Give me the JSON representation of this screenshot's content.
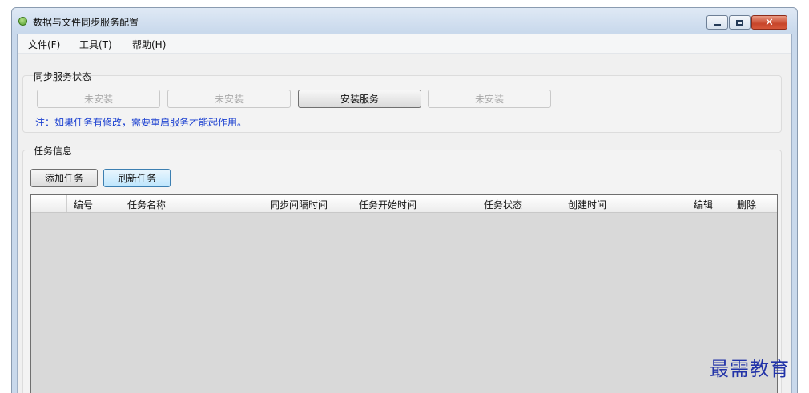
{
  "window": {
    "title": "数据与文件同步服务配置",
    "controls": {
      "minimize": "minimize-icon",
      "maximize": "maximize-icon",
      "close_glyph": "✕"
    }
  },
  "menu": [
    "文件(F)",
    "工具(T)",
    "帮助(H)"
  ],
  "service_status": {
    "title": "同步服务状态",
    "buttons": [
      {
        "label": "未安装",
        "enabled": false
      },
      {
        "label": "未安装",
        "enabled": false
      },
      {
        "label": "安装服务",
        "enabled": true
      },
      {
        "label": "未安装",
        "enabled": false
      }
    ],
    "note": "注：如果任务有修改，需要重启服务才能起作用。"
  },
  "task_info": {
    "title": "任务信息",
    "add_label": "添加任务",
    "refresh_label": "刷新任务",
    "columns": [
      "编号",
      "任务名称",
      "同步间隔时间",
      "任务开始时间",
      "任务状态",
      "创建时间",
      "编辑",
      "删除"
    ],
    "rows": []
  },
  "watermark": "最需教育",
  "colors": {
    "note": "#1a3fd0",
    "close_button": "#c7452a",
    "watermark": "#2233a8"
  }
}
